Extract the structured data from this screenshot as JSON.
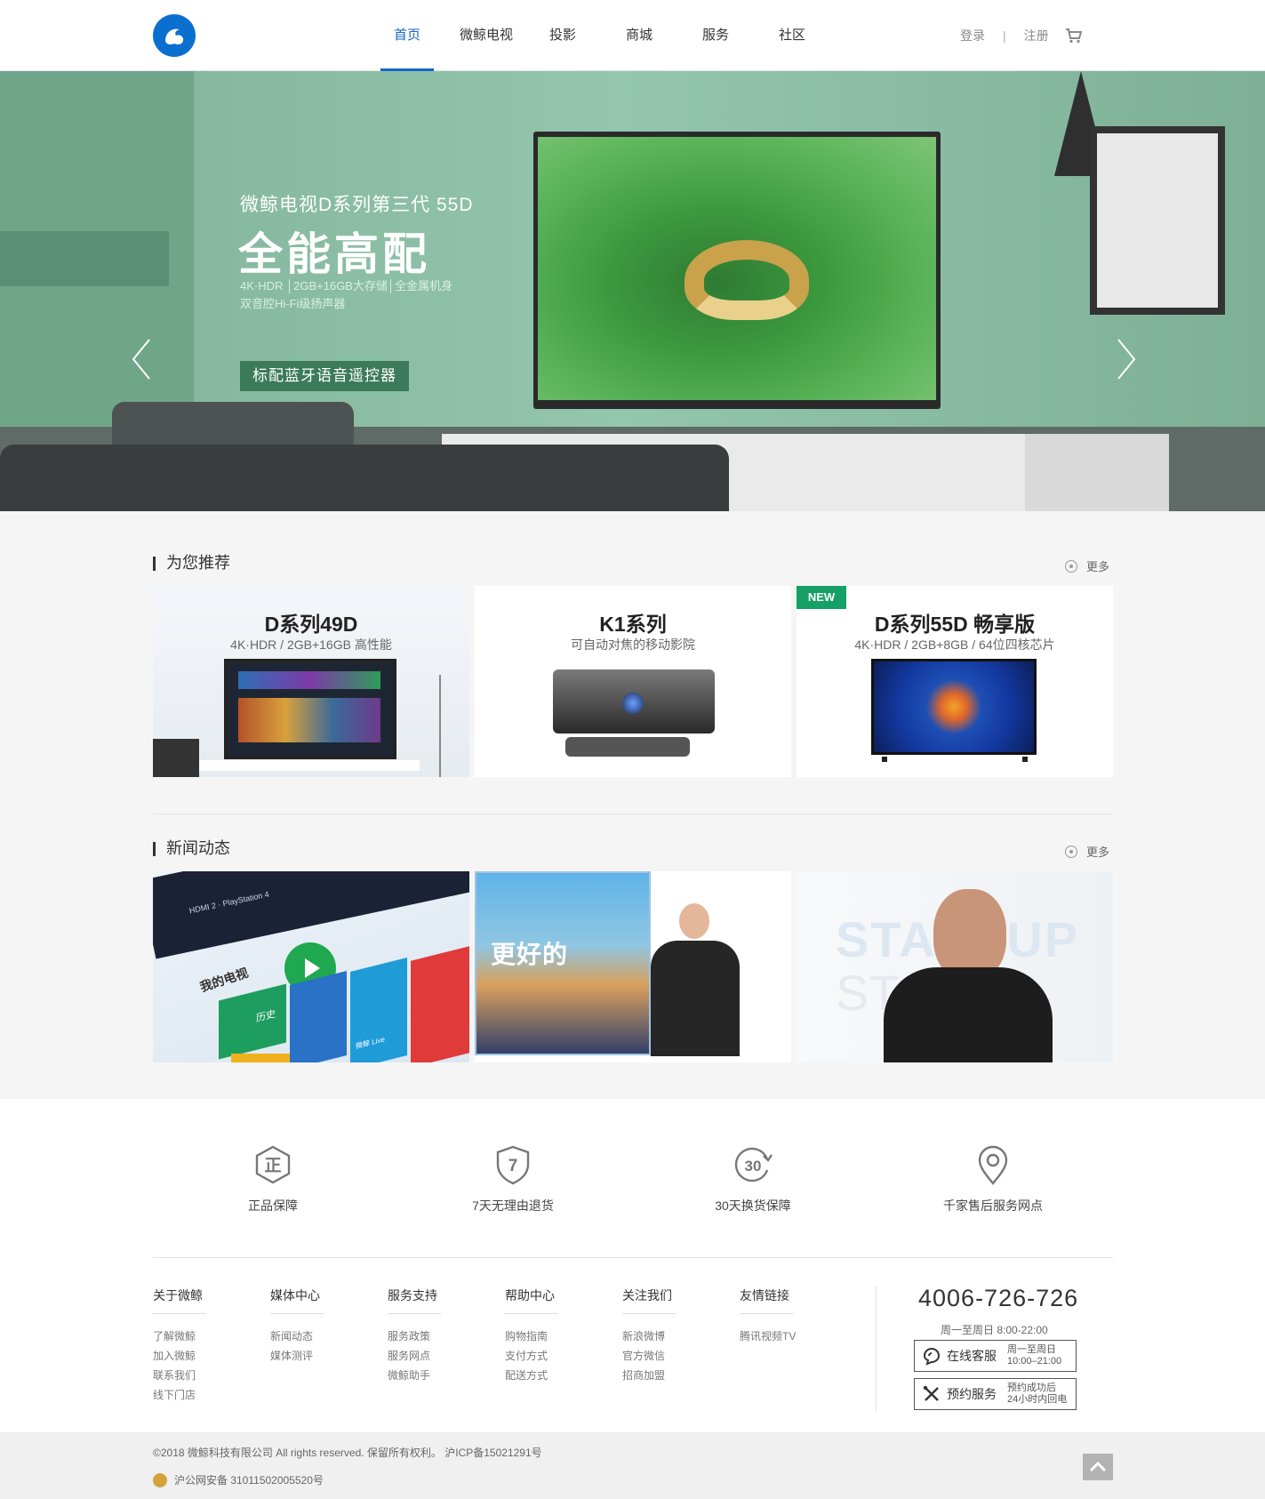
{
  "header": {
    "nav": [
      {
        "label": "首页",
        "active": true
      },
      {
        "label": "微鲸电视",
        "active": false
      },
      {
        "label": "投影",
        "active": false
      },
      {
        "label": "商城",
        "active": false
      },
      {
        "label": "服务",
        "active": false
      },
      {
        "label": "社区",
        "active": false
      }
    ],
    "login": "登录",
    "separator": "|",
    "register": "注册",
    "accent_color": "#1565c8"
  },
  "hero": {
    "subtitle": "微鲸电视D系列第三代 55D",
    "title": "全能高配",
    "spec_line1": "4K·HDR │2GB+16GB大存储│全金属机身",
    "spec_line2": "双音腔Hi-Fi级扬声器",
    "badge": "标配蓝牙语音遥控器",
    "slide_count": 6,
    "active_slide": 2
  },
  "recommend": {
    "title": "为您推荐",
    "more": "更多",
    "cards": [
      {
        "title": "D系列49D",
        "subtitle": "4K·HDR / 2GB+16GB 高性能",
        "badge": ""
      },
      {
        "title": "K1系列",
        "subtitle": "可自动对焦的移动影院",
        "badge": ""
      },
      {
        "title": "D系列55D 畅享版",
        "subtitle": "4K·HDR / 2GB+8GB / 64位四核芯片",
        "badge": "NEW"
      }
    ],
    "badge_color": "#16a068"
  },
  "news": {
    "title": "新闻动态",
    "more": "更多",
    "items": [
      {
        "texts": [
          "HDMI 2 · PlayStation 4",
          "我的电视",
          "历史",
          "微鲸 Live"
        ]
      },
      {
        "texts": [
          "更好的"
        ]
      },
      {
        "texts": [
          "STARTUP",
          "ST"
        ]
      }
    ]
  },
  "services": [
    {
      "icon": "genuine-icon",
      "glyph": "正",
      "label": "正品保障"
    },
    {
      "icon": "return-7-day-icon",
      "glyph": "7",
      "label": "7天无理由退货"
    },
    {
      "icon": "exchange-30-day-icon",
      "glyph": "30",
      "label": "30天换货保障"
    },
    {
      "icon": "location-pin-icon",
      "glyph": "",
      "label": "千家售后服务网点"
    }
  ],
  "footer": {
    "columns": [
      {
        "heading": "关于微鲸",
        "links": [
          "了解微鲸",
          "加入微鲸",
          "联系我们",
          "线下门店"
        ]
      },
      {
        "heading": "媒体中心",
        "links": [
          "新闻动态",
          "媒体测评"
        ]
      },
      {
        "heading": "服务支持",
        "links": [
          "服务政策",
          "服务网点",
          "微鲸助手"
        ]
      },
      {
        "heading": "帮助中心",
        "links": [
          "购物指南",
          "支付方式",
          "配送方式"
        ]
      },
      {
        "heading": "关注我们",
        "links": [
          "新浪微博",
          "官方微信",
          "招商加盟"
        ]
      },
      {
        "heading": "友情链接",
        "links": [
          "腾讯视频TV"
        ]
      }
    ],
    "phone": "4006-726-726",
    "hours": "周一至周日 8:00-22:00",
    "online_service": {
      "label": "在线客服",
      "sub1": "周一至周日",
      "sub2": "10:00–21:00"
    },
    "booking_service": {
      "label": "预约服务",
      "sub1": "预约成功后",
      "sub2": "24小时内回电"
    }
  },
  "bottom": {
    "copyright": "©2018 微鲸科技有限公司 All rights reserved. 保留所有权利。 沪ICP备15021291号",
    "beian": "沪公网安备 31011502005520号"
  }
}
